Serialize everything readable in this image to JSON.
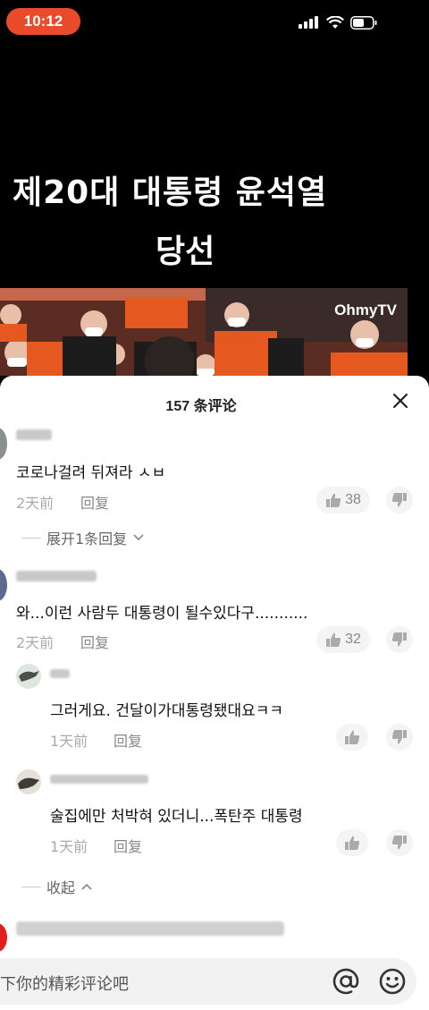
{
  "status_bar": {
    "time": "10:12"
  },
  "video": {
    "caption_line1": "제20대 대통령 윤석열",
    "caption_line2": "당선",
    "watermark": "OhmyTV"
  },
  "comments_panel": {
    "title": "157 条评论",
    "comments": [
      {
        "text": "코로나걸려 뒤져라 ㅅㅂ",
        "time": "2天前",
        "reply_label": "回复",
        "likes": "38"
      },
      {
        "text": "와...이런 사람두 대통령이 될수있다구...........",
        "time": "2天前",
        "reply_label": "回复",
        "likes": "32"
      }
    ],
    "expand_label": "展开1条回复",
    "replies": [
      {
        "text": "그러게요. 건달이가대통령됐대요ㅋㅋ",
        "time": "1天前",
        "reply_label": "回复"
      },
      {
        "text": "술집에만 처박혀 있더니...폭탄주 대통령",
        "time": "1天前",
        "reply_label": "回复"
      }
    ],
    "collapse_label": "收起"
  },
  "input": {
    "placeholder": "下你的精彩评论吧"
  }
}
